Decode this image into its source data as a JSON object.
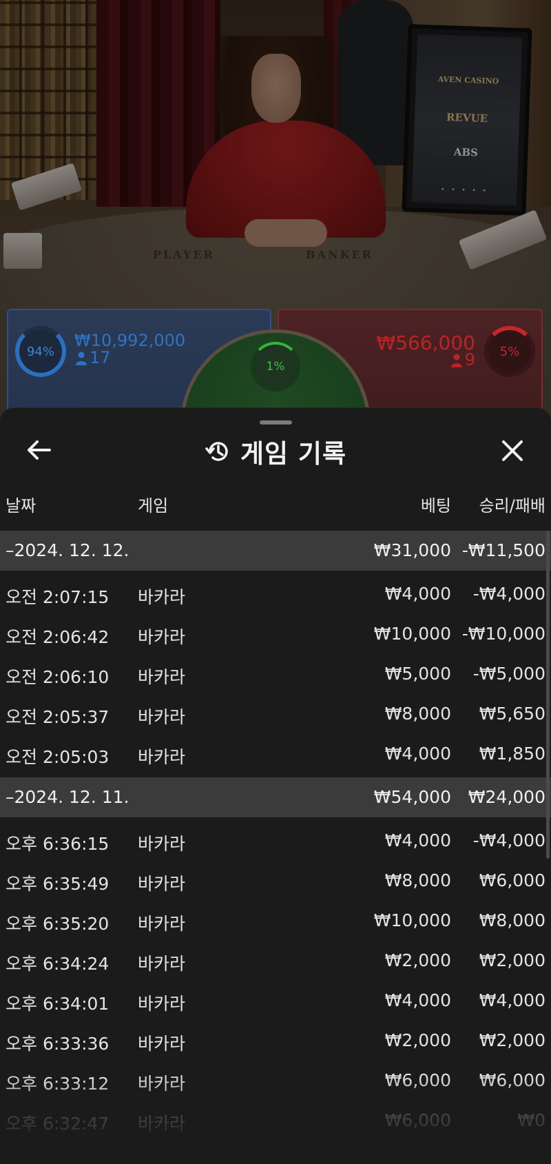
{
  "video": {
    "table_player_label": "PLAYER",
    "table_banker_label": "BANKER",
    "screen_logos": [
      "AVEN CASINO",
      "REVUE",
      "ABS"
    ],
    "colors": {
      "curtain": "#55161a",
      "table": "#5d5243"
    }
  },
  "bets": {
    "player": {
      "percent": "94%",
      "amount": "₩10,992,000",
      "players": "17",
      "color": "#2a6fc0"
    },
    "banker": {
      "percent": "5%",
      "amount": "₩566,000",
      "players": "9",
      "color": "#c0282c"
    },
    "tie": {
      "percent": "1%",
      "color": "#35b33c"
    }
  },
  "sheet": {
    "title": "게임 기록",
    "back_icon": "arrow-left-icon",
    "close_icon": "close-icon",
    "history_icon": "history-icon",
    "columns": {
      "date": "날짜",
      "game": "게임",
      "bet": "베팅",
      "win_loss": "승리/패배"
    },
    "groups": [
      {
        "date": "–2024. 12. 12.",
        "bet_total": "₩31,000",
        "win_total": "-₩11,500",
        "rows": [
          {
            "time": "오전 2:07:15",
            "game": "바카라",
            "bet": "₩4,000",
            "win": "-₩4,000"
          },
          {
            "time": "오전 2:06:42",
            "game": "바카라",
            "bet": "₩10,000",
            "win": "-₩10,000"
          },
          {
            "time": "오전 2:06:10",
            "game": "바카라",
            "bet": "₩5,000",
            "win": "-₩5,000"
          },
          {
            "time": "오전 2:05:37",
            "game": "바카라",
            "bet": "₩8,000",
            "win": "₩5,650"
          },
          {
            "time": "오전 2:05:03",
            "game": "바카라",
            "bet": "₩4,000",
            "win": "₩1,850"
          }
        ]
      },
      {
        "date": "–2024. 12. 11.",
        "bet_total": "₩54,000",
        "win_total": "₩24,000",
        "rows": [
          {
            "time": "오후 6:36:15",
            "game": "바카라",
            "bet": "₩4,000",
            "win": "-₩4,000"
          },
          {
            "time": "오후 6:35:49",
            "game": "바카라",
            "bet": "₩8,000",
            "win": "₩6,000"
          },
          {
            "time": "오후 6:35:20",
            "game": "바카라",
            "bet": "₩10,000",
            "win": "₩8,000"
          },
          {
            "time": "오후 6:34:24",
            "game": "바카라",
            "bet": "₩2,000",
            "win": "₩2,000"
          },
          {
            "time": "오후 6:34:01",
            "game": "바카라",
            "bet": "₩4,000",
            "win": "₩4,000"
          },
          {
            "time": "오후 6:33:36",
            "game": "바카라",
            "bet": "₩2,000",
            "win": "₩2,000"
          },
          {
            "time": "오후 6:33:12",
            "game": "바카라",
            "bet": "₩6,000",
            "win": "₩6,000"
          },
          {
            "time": "오후 6:32:47",
            "game": "바카라",
            "bet": "₩6,000",
            "win": "₩0"
          }
        ]
      }
    ]
  }
}
